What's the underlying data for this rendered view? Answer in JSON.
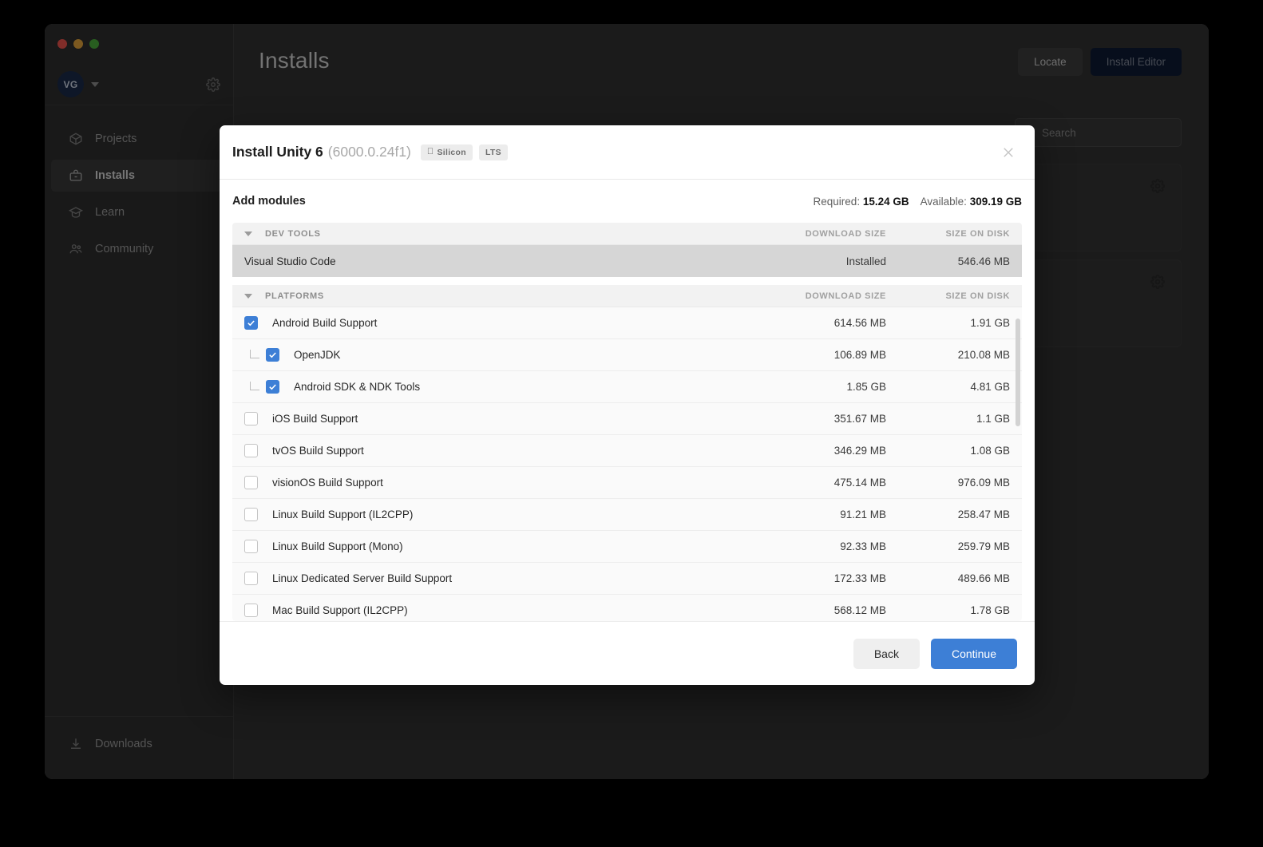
{
  "window": {
    "traffic_lights": [
      "close",
      "minimize",
      "maximize"
    ]
  },
  "sidebar": {
    "account": {
      "initials": "VG",
      "caret": "chevron-down-icon",
      "settings_icon": "gear-icon"
    },
    "items": [
      {
        "label": "Projects",
        "icon": "cube-icon",
        "active": false
      },
      {
        "label": "Installs",
        "icon": "toolbox-icon",
        "active": true
      },
      {
        "label": "Learn",
        "icon": "graduation-cap-icon",
        "active": false
      },
      {
        "label": "Community",
        "icon": "people-icon",
        "active": false
      }
    ],
    "bottom": {
      "label": "Downloads",
      "icon": "download-icon"
    }
  },
  "header": {
    "title": "Installs",
    "locate_label": "Locate",
    "install_editor_label": "Install Editor"
  },
  "search": {
    "placeholder": "Search",
    "icon": "search-icon"
  },
  "modal": {
    "title": "Install Unity 6",
    "version": "(6000.0.24f1)",
    "badges": [
      {
        "label": "Silicon",
        "icon": "apple-icon"
      },
      {
        "label": "LTS",
        "icon": ""
      }
    ],
    "close_icon": "close-icon",
    "section_title": "Add modules",
    "required_label": "Required:",
    "required_value": "15.24 GB",
    "available_label": "Available:",
    "available_value": "309.19 GB",
    "columns": {
      "download": "DOWNLOAD SIZE",
      "disk": "SIZE ON DISK"
    },
    "groups": [
      {
        "label": "DEV TOOLS",
        "rows": [
          {
            "name": "Visual Studio Code",
            "download": "Installed",
            "disk": "546.46 MB",
            "checkbox": "none",
            "indent": 0,
            "highlighted": true
          }
        ]
      },
      {
        "label": "PLATFORMS",
        "rows": [
          {
            "name": "Android Build Support",
            "download": "614.56 MB",
            "disk": "1.91 GB",
            "checkbox": "checked",
            "indent": 0,
            "highlighted": false
          },
          {
            "name": "OpenJDK",
            "download": "106.89 MB",
            "disk": "210.08 MB",
            "checkbox": "checked",
            "indent": 1,
            "highlighted": false
          },
          {
            "name": "Android SDK & NDK Tools",
            "download": "1.85 GB",
            "disk": "4.81 GB",
            "checkbox": "checked",
            "indent": 1,
            "highlighted": false
          },
          {
            "name": "iOS Build Support",
            "download": "351.67 MB",
            "disk": "1.1 GB",
            "checkbox": "unchecked",
            "indent": 0,
            "highlighted": false
          },
          {
            "name": "tvOS Build Support",
            "download": "346.29 MB",
            "disk": "1.08 GB",
            "checkbox": "unchecked",
            "indent": 0,
            "highlighted": false
          },
          {
            "name": "visionOS Build Support",
            "download": "475.14 MB",
            "disk": "976.09 MB",
            "checkbox": "unchecked",
            "indent": 0,
            "highlighted": false
          },
          {
            "name": "Linux Build Support (IL2CPP)",
            "download": "91.21 MB",
            "disk": "258.47 MB",
            "checkbox": "unchecked",
            "indent": 0,
            "highlighted": false
          },
          {
            "name": "Linux Build Support (Mono)",
            "download": "92.33 MB",
            "disk": "259.79 MB",
            "checkbox": "unchecked",
            "indent": 0,
            "highlighted": false
          },
          {
            "name": "Linux Dedicated Server Build Support",
            "download": "172.33 MB",
            "disk": "489.66 MB",
            "checkbox": "unchecked",
            "indent": 0,
            "highlighted": false
          },
          {
            "name": "Mac Build Support (IL2CPP)",
            "download": "568.12 MB",
            "disk": "1.78 GB",
            "checkbox": "unchecked",
            "indent": 0,
            "highlighted": false
          }
        ]
      }
    ],
    "footer": {
      "back_label": "Back",
      "continue_label": "Continue"
    }
  },
  "background_cards": [
    {
      "gear_icon": "gear-icon"
    },
    {
      "gear_icon": "gear-icon"
    }
  ],
  "colors": {
    "accent": "#3d7fd6",
    "modal_bg": "#ffffff",
    "app_bg": "#323232",
    "sidebar_bg": "#2f2f2f",
    "install_editor_bg": "#0e1b33"
  }
}
